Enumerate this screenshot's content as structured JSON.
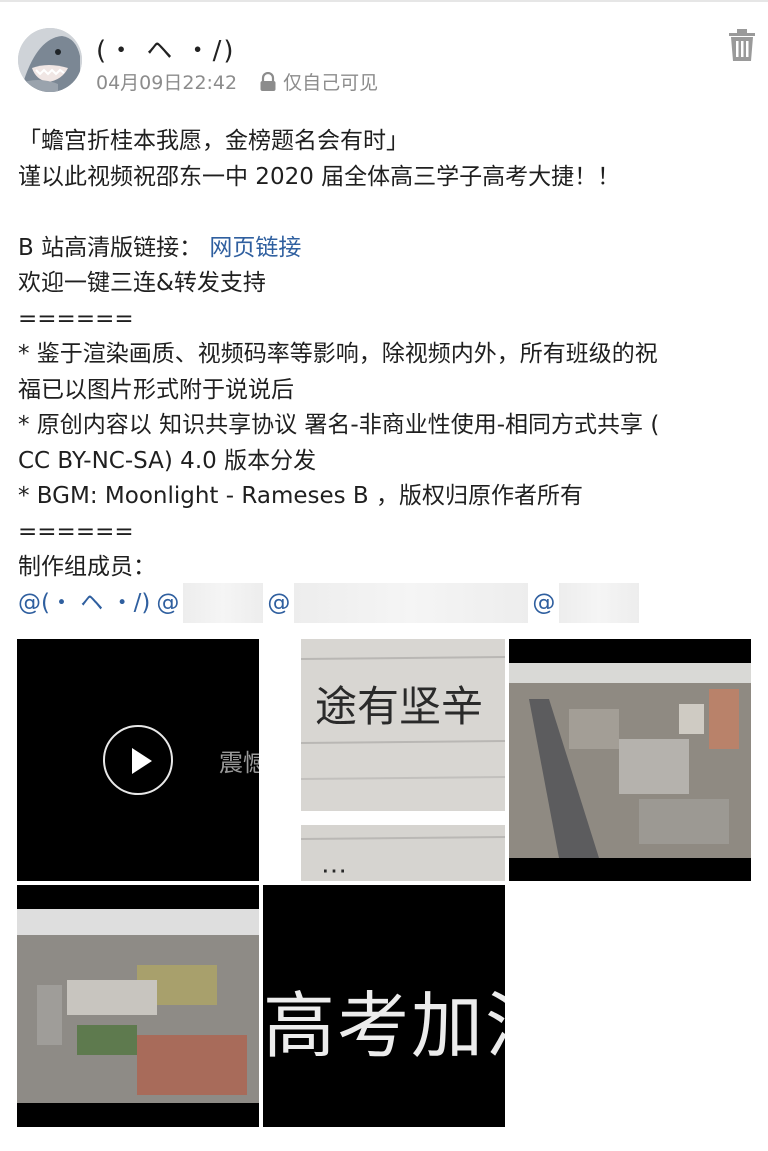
{
  "post": {
    "author": "(・ ヘ ・/)",
    "date": "04月09日22:42",
    "privacy": "仅自己可见",
    "lines": {
      "l1": "「蟾宫折桂本我愿，金榜题名会有时」",
      "l2": "谨以此视频祝邵东一中 2020 届全体高三学子高考大捷！！",
      "l3_prefix": "B 站高清版链接：",
      "l3_link": "网页链接",
      "l4": "欢迎一键三连&转发支持",
      "l5": "======",
      "l6": "* 鉴于渲染画质、视频码率等影响，除视频内外，所有班级的祝",
      "l7": "福已以图片形式附于说说后",
      "l8": "* 原创内容以 知识共享协议 署名-非商业性使用-相同方式共享 (",
      "l9": "CC BY-NC-SA) 4.0 版本分发",
      "l10": "* BGM: Moonlight - Rameses B ，版权归原作者所有",
      "l11": "======",
      "l12": "制作组成员：",
      "mention1": "@(・ ヘ ・/)",
      "mention_at": "@"
    }
  },
  "media": {
    "video_caption": "震憾",
    "handwriting": "途有坚辛",
    "banner_text": "高考加油"
  },
  "icons": {
    "trash": "trash-icon",
    "lock": "lock-icon",
    "play": "play-icon"
  },
  "colors": {
    "link": "#2f5f9f",
    "meta": "#8c8c8c"
  }
}
